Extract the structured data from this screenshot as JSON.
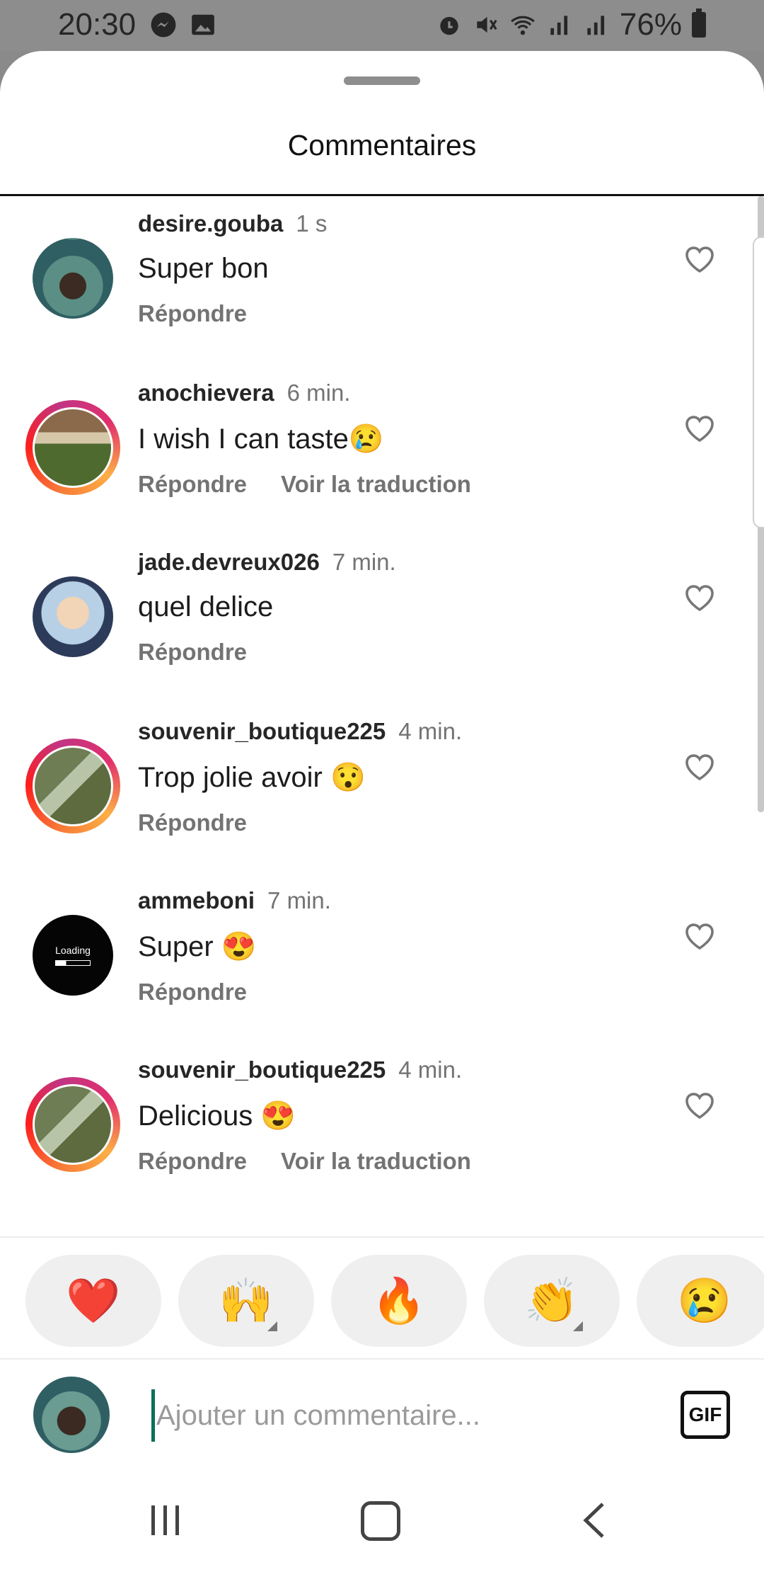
{
  "status_bar": {
    "time": "20:30",
    "battery": "76%",
    "left_icons": [
      "messenger-icon",
      "image-icon"
    ],
    "right_icons": [
      "alarm-icon",
      "mute-icon",
      "wifi-icon",
      "signal-icon",
      "signal-icon",
      "battery-icon"
    ]
  },
  "sheet": {
    "title": "Commentaires"
  },
  "comments": [
    {
      "user": "desire.gouba",
      "time": "1 s",
      "text": "Super bon",
      "reply": "Répondre",
      "translate": ""
    },
    {
      "user": "anochievera",
      "time": "6 min.",
      "text": "I wish I can taste😢",
      "reply": "Répondre",
      "translate": "Voir la traduction"
    },
    {
      "user": "jade.devreux026",
      "time": "7 min.",
      "text": "quel delice",
      "reply": "Répondre",
      "translate": ""
    },
    {
      "user": "souvenir_boutique225",
      "time": "4 min.",
      "text": "Trop jolie avoir 😯",
      "reply": "Répondre",
      "translate": ""
    },
    {
      "user": "ammeboni",
      "time": "7 min.",
      "text": "Super 😍",
      "reply": "Répondre",
      "translate": "",
      "avatar_text": "Loading"
    },
    {
      "user": "souvenir_boutique225",
      "time": "4 min.",
      "text": "Delicious 😍",
      "reply": "Répondre",
      "translate": "Voir la traduction"
    }
  ],
  "emoji_bar": [
    "❤️",
    "🙌",
    "🔥",
    "👏",
    "😢"
  ],
  "composer": {
    "placeholder": "Ajouter un commentaire...",
    "gif_label": "GIF"
  },
  "colors": {
    "sheet_bg": "#ffffff",
    "secondary_text": "#737373",
    "story_ring": "#e1306c"
  }
}
